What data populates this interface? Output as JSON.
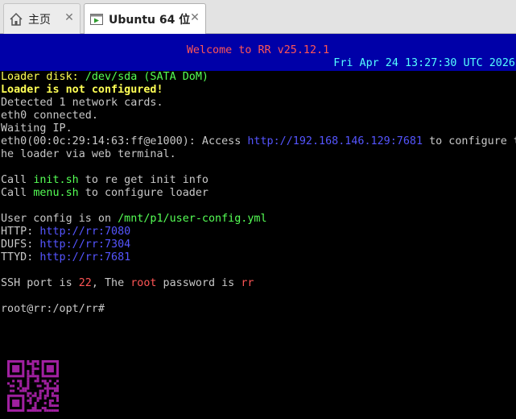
{
  "tabs": [
    {
      "label": "主页",
      "icon": "home-icon",
      "close": "✕"
    },
    {
      "label": "Ubuntu 64 位",
      "icon": "vm-icon",
      "close": "✕"
    }
  ],
  "banner": {
    "title": "Welcome to RR v25.12.1",
    "datetime": "Fri Apr 24 13:27:30 UTC 2026"
  },
  "terminal": {
    "loader_disk_label": "Loader disk: ",
    "loader_disk_value": "/dev/sda (SATA DoM)",
    "not_configured": "Loader is not configured!",
    "detected": "Detected 1 network cards.",
    "connected": "eth0 connected.",
    "waiting": "Waiting IP.",
    "access_prefix": "eth0(00:0c:29:14:63:ff@e1000): Access ",
    "access_url": "http://192.168.146.129:7681",
    "access_suffix": " to configure t",
    "access_cont": "he loader via web terminal.",
    "call1_prefix": "Call ",
    "call1_cmd": "init.sh",
    "call1_suffix": " to re get init info",
    "call2_prefix": "Call ",
    "call2_cmd": "menu.sh",
    "call2_suffix": " to configure loader",
    "userconfig_prefix": "User config is on ",
    "userconfig_path": "/mnt/p1/user-config.yml",
    "http_label": "HTTP: ",
    "http_url": "http://rr:7080",
    "dufs_label": "DUFS: ",
    "dufs_url": "http://rr:7304",
    "ttyd_label": "TTYD: ",
    "ttyd_url": "http://rr:7681",
    "ssh_prefix": "SSH port is ",
    "ssh_port": "22",
    "ssh_mid": ", The ",
    "ssh_user": "root",
    "ssh_mid2": " password is ",
    "ssh_pass": "rr",
    "prompt": "root@rr:/opt/rr#"
  },
  "colors": {
    "banner_bg": "#0000a8",
    "banner_title": "#ff5555",
    "banner_date": "#55ffff",
    "warning": "#ffff55",
    "highlight": "#55ff55",
    "link": "#5555ff",
    "red": "#ff5555",
    "qr": "#a020a0"
  }
}
